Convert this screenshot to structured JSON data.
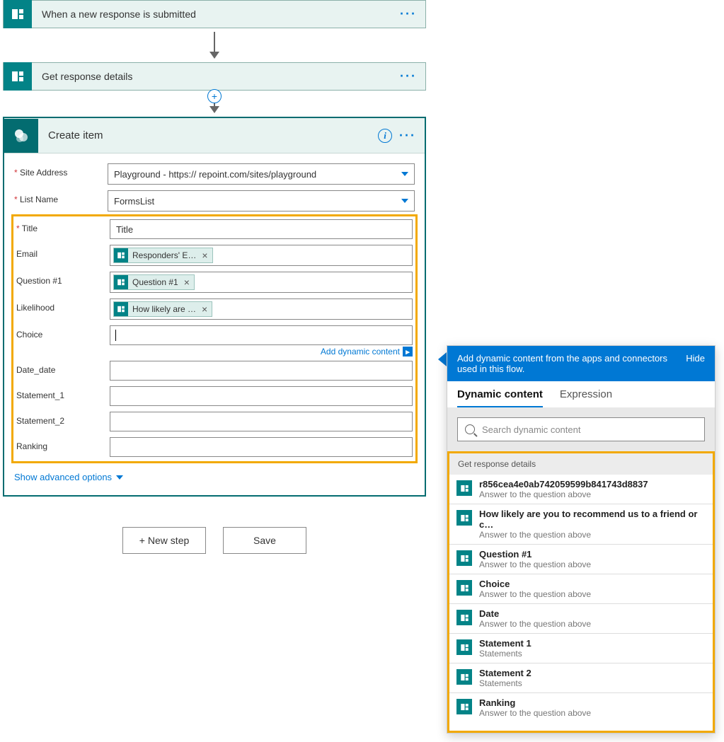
{
  "flow": {
    "step1_title": "When a new response is submitted",
    "step2_title": "Get response details",
    "step3_title": "Create item"
  },
  "createItem": {
    "fields": {
      "siteAddress": {
        "label": "Site Address",
        "value": "Playground - https://                        repoint.com/sites/playground"
      },
      "listName": {
        "label": "List Name",
        "value": "FormsList"
      },
      "title": {
        "label": "Title",
        "value": "Title"
      },
      "email": {
        "label": "Email",
        "token": "Responders' E…"
      },
      "question1": {
        "label": "Question #1",
        "token": "Question #1"
      },
      "likelihood": {
        "label": "Likelihood",
        "token": "How likely are …"
      },
      "choice": {
        "label": "Choice"
      },
      "date": {
        "label": "Date_date"
      },
      "statement1": {
        "label": "Statement_1"
      },
      "statement2": {
        "label": "Statement_2"
      },
      "ranking": {
        "label": "Ranking"
      }
    },
    "addDynamic": "Add dynamic content",
    "showAdvanced": "Show advanced options"
  },
  "buttons": {
    "newStep": "New step",
    "save": "Save"
  },
  "dynPanel": {
    "headerText": "Add dynamic content from the apps and connectors used in this flow.",
    "hide": "Hide",
    "tabDynamic": "Dynamic content",
    "tabExpression": "Expression",
    "searchPlaceholder": "Search dynamic content",
    "sectionTitle": "Get response details",
    "items": [
      {
        "title": "r856cea4e0ab742059599b841743d8837",
        "sub": "Answer to the question above"
      },
      {
        "title": "How likely are you to recommend us to a friend or c…",
        "sub": "Answer to the question above"
      },
      {
        "title": "Question #1",
        "sub": "Answer to the question above"
      },
      {
        "title": "Choice",
        "sub": "Answer to the question above"
      },
      {
        "title": "Date",
        "sub": "Answer to the question above"
      },
      {
        "title": "Statement 1",
        "sub": "Statements"
      },
      {
        "title": "Statement 2",
        "sub": "Statements"
      },
      {
        "title": "Ranking",
        "sub": "Answer to the question above"
      }
    ]
  }
}
